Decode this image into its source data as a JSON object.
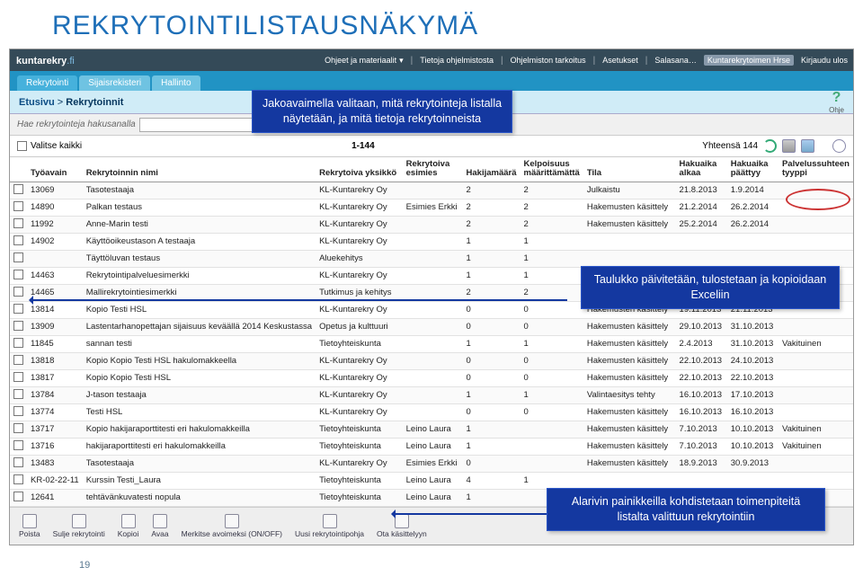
{
  "slide_title": "REKRYTOINTILISTAUSNÄKYMÄ",
  "page_number": "19",
  "logo_main": "kuntarekry",
  "logo_suffix": ".fi",
  "top_menu": {
    "items": [
      "Ohjeet ja materiaalit",
      "Tietoja ohjelmistosta",
      "Ohjelmiston tarkoitus",
      "Asetukset",
      "Salasana…"
    ],
    "user": "Kuntarekrytoimen Hrse",
    "logout": "Kirjaudu ulos"
  },
  "tabs": [
    "Rekrytointi",
    "Sijaisrekisteri",
    "Hallinto"
  ],
  "breadcrumb": {
    "root": "Etusivu",
    "sep": ">",
    "current": "Rekrytoinnit"
  },
  "help_label": "Ohje",
  "search": {
    "label": "Hae rekrytointeja hakusanalla",
    "placeholder": ""
  },
  "select_all": "Valitse kaikki",
  "range": "1-144",
  "total_label": "Yhteensä 144",
  "headers": {
    "key": "Työavain",
    "name": "Rekrytoinnin nimi",
    "unit": "Rekrytoiva yksikkö",
    "mgr": "Rekrytoiva esimies",
    "apps": "Hakijamäärä",
    "elig": "Kelpoisuus määrittämättä",
    "status": "Tila",
    "start": "Hakuaika alkaa",
    "end": "Hakuaika päättyy",
    "type": "Palvelussuhteen tyyppi"
  },
  "rows": [
    {
      "k": "13069",
      "n": "Tasotestaaja",
      "u": "KL-Kuntarekry Oy",
      "m": "",
      "a": "2",
      "e": "2",
      "s": "Julkaistu",
      "d1": "21.8.2013",
      "d2": "1.9.2014",
      "t": ""
    },
    {
      "k": "14890",
      "n": "Palkan testaus",
      "u": "KL-Kuntarekry Oy",
      "m": "Esimies Erkki",
      "a": "2",
      "e": "2",
      "s": "Hakemusten käsittely",
      "d1": "21.2.2014",
      "d2": "26.2.2014",
      "t": ""
    },
    {
      "k": "11992",
      "n": "Anne-Marin testi",
      "u": "KL-Kuntarekry Oy",
      "m": "",
      "a": "2",
      "e": "2",
      "s": "Hakemusten käsittely",
      "d1": "25.2.2014",
      "d2": "26.2.2014",
      "t": ""
    },
    {
      "k": "14902",
      "n": "Käyttöoikeustason A testaaja",
      "u": "KL-Kuntarekry Oy",
      "m": "",
      "a": "1",
      "e": "1",
      "s": "",
      "d1": "",
      "d2": "",
      "t": ""
    },
    {
      "k": "",
      "n": "Täyttöluvan testaus",
      "u": "Aluekehitys",
      "m": "",
      "a": "1",
      "e": "1",
      "s": "",
      "d1": "",
      "d2": "",
      "t": ""
    },
    {
      "k": "14463",
      "n": "Rekrytointipalveluesimerkki",
      "u": "KL-Kuntarekry Oy",
      "m": "",
      "a": "1",
      "e": "1",
      "s": "",
      "d1": "",
      "d2": "",
      "t": ""
    },
    {
      "k": "14465",
      "n": "Mallirekrytointiesimerkki",
      "u": "Tutkimus ja kehitys",
      "m": "",
      "a": "2",
      "e": "2",
      "s": "",
      "d1": "",
      "d2": "",
      "t": ""
    },
    {
      "k": "13814",
      "n": "Kopio Testi HSL",
      "u": "KL-Kuntarekry Oy",
      "m": "",
      "a": "0",
      "e": "0",
      "s": "Hakemusten käsittely",
      "d1": "19.11.2013",
      "d2": "21.11.2013",
      "t": ""
    },
    {
      "k": "13909",
      "n": "Lastentarhanopettajan sijaisuus keväällä 2014 Keskustassa",
      "u": "Opetus ja kulttuuri",
      "m": "",
      "a": "0",
      "e": "0",
      "s": "Hakemusten käsittely",
      "d1": "29.10.2013",
      "d2": "31.10.2013",
      "t": ""
    },
    {
      "k": "11845",
      "n": "sannan testi",
      "u": "Tietoyhteiskunta",
      "m": "",
      "a": "1",
      "e": "1",
      "s": "Hakemusten käsittely",
      "d1": "2.4.2013",
      "d2": "31.10.2013",
      "t": "Vakituinen"
    },
    {
      "k": "13818",
      "n": "Kopio Kopio Testi HSL hakulomakkeella",
      "u": "KL-Kuntarekry Oy",
      "m": "",
      "a": "0",
      "e": "0",
      "s": "Hakemusten käsittely",
      "d1": "22.10.2013",
      "d2": "24.10.2013",
      "t": ""
    },
    {
      "k": "13817",
      "n": "Kopio Kopio Testi HSL",
      "u": "KL-Kuntarekry Oy",
      "m": "",
      "a": "0",
      "e": "0",
      "s": "Hakemusten käsittely",
      "d1": "22.10.2013",
      "d2": "22.10.2013",
      "t": ""
    },
    {
      "k": "13784",
      "n": "J-tason testaaja",
      "u": "KL-Kuntarekry Oy",
      "m": "",
      "a": "1",
      "e": "1",
      "s": "Valintaesitys tehty",
      "d1": "16.10.2013",
      "d2": "17.10.2013",
      "t": ""
    },
    {
      "k": "13774",
      "n": "Testi HSL",
      "u": "KL-Kuntarekry Oy",
      "m": "",
      "a": "0",
      "e": "0",
      "s": "Hakemusten käsittely",
      "d1": "16.10.2013",
      "d2": "16.10.2013",
      "t": ""
    },
    {
      "k": "13717",
      "n": "Kopio hakijaraporttitesti eri hakulomakkeilla",
      "u": "Tietoyhteiskunta",
      "m": "Leino Laura",
      "a": "1",
      "e": "",
      "s": "Hakemusten käsittely",
      "d1": "7.10.2013",
      "d2": "10.10.2013",
      "t": "Vakituinen"
    },
    {
      "k": "13716",
      "n": "hakijaraporttitesti eri hakulomakkeilla",
      "u": "Tietoyhteiskunta",
      "m": "Leino Laura",
      "a": "1",
      "e": "",
      "s": "Hakemusten käsittely",
      "d1": "7.10.2013",
      "d2": "10.10.2013",
      "t": "Vakituinen"
    },
    {
      "k": "13483",
      "n": "Tasotestaaja",
      "u": "KL-Kuntarekry Oy",
      "m": "Esimies Erkki",
      "a": "0",
      "e": "",
      "s": "Hakemusten käsittely",
      "d1": "18.9.2013",
      "d2": "30.9.2013",
      "t": ""
    },
    {
      "k": "KR-02-22-11",
      "n": "Kurssin Testi_Laura",
      "u": "Tietoyhteiskunta",
      "m": "Leino Laura",
      "a": "4",
      "e": "1",
      "s": "",
      "d1": "",
      "d2": "",
      "t": ""
    },
    {
      "k": "12641",
      "n": "tehtävänkuvatesti nopula",
      "u": "Tietoyhteiskunta",
      "m": "Leino Laura",
      "a": "1",
      "e": "",
      "s": "",
      "d1": "",
      "d2": "",
      "t": ""
    }
  ],
  "toolbar": {
    "delete": "Poista",
    "close": "Sulje rekrytointi",
    "copy": "Kopioi",
    "open": "Avaa",
    "mark": "Merkitse avoimeksi (ON/OFF)",
    "new": "Uusi rekrytointipohja",
    "take": "Ota käsittelyyn"
  },
  "callouts": {
    "c1": "Jakoavaimella valitaan, mitä rekrytointeja listalla näytetään, ja mitä tietoja rekrytoinneista",
    "c2": "Taulukko päivitetään, tulostetaan ja kopioidaan Exceliin",
    "c3": "Alarivin painikkeilla kohdistetaan toimenpiteitä listalta valittuun rekrytointiin"
  }
}
